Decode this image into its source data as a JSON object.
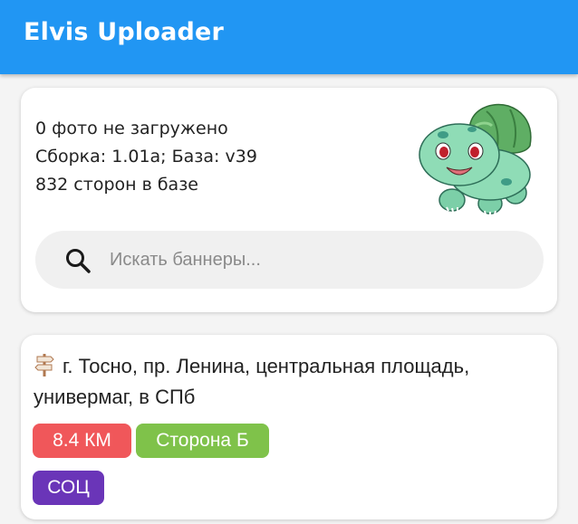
{
  "app": {
    "title": "Elvis Uploader",
    "primary_color": "#2196f3"
  },
  "info": {
    "photos": "0 фото не загружено",
    "build": "Сборка: 1.01a; База: v39",
    "sides": "832 сторон в базе",
    "mascot_icon": "bulbasaur-mascot"
  },
  "search": {
    "placeholder": "Искать баннеры...",
    "value": "",
    "icon": "search-icon"
  },
  "banner": {
    "icon": "signpost-icon",
    "address": "г. Тосно, пр. Ленина, центральная площадь, универмаг,  в СПб",
    "badges": [
      {
        "label": "8.4 КМ",
        "color": "#f0575a"
      },
      {
        "label": "Сторона Б",
        "color": "#7fc24a"
      },
      {
        "label": "СОЦ",
        "color": "#6a35b8"
      }
    ]
  }
}
